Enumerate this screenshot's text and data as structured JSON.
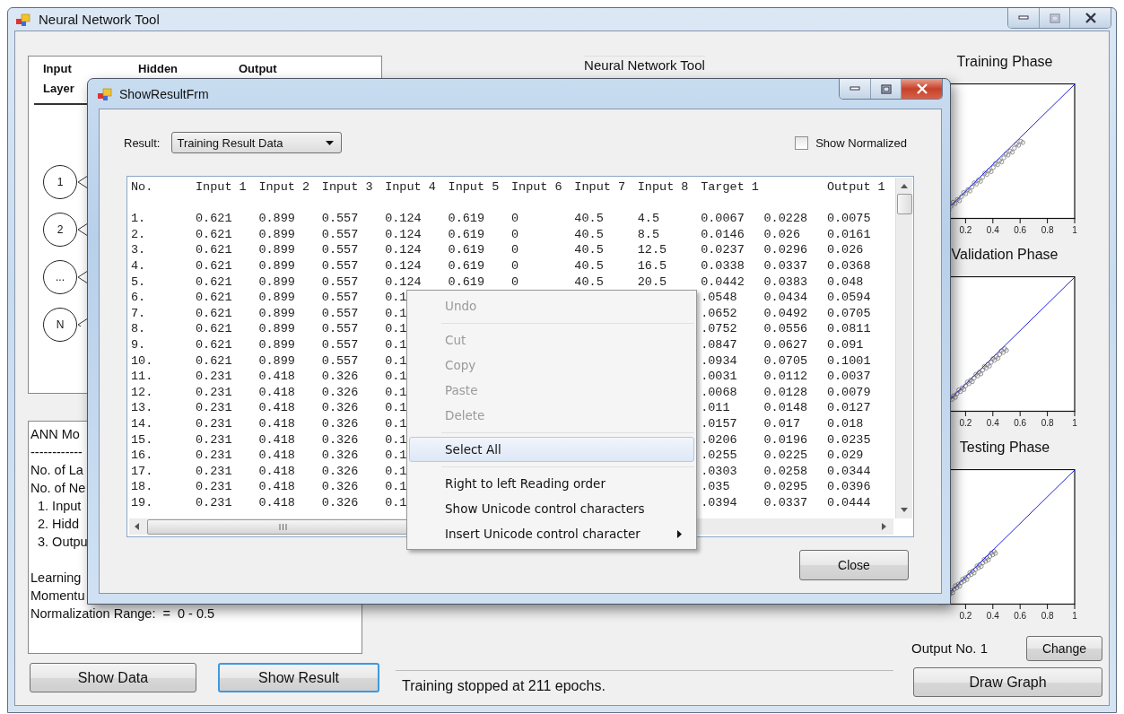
{
  "window": {
    "title": "Neural Network Tool"
  },
  "layer_tabs": [
    {
      "label": "Input Layer",
      "selected": true
    },
    {
      "label": "Hidden",
      "selected": false
    },
    {
      "label": "Output",
      "selected": false
    }
  ],
  "nodes": [
    "1",
    "2",
    "...",
    "N"
  ],
  "summary": {
    "header_lines": [
      "ANN Mo",
      "------------",
      "No. of La",
      "No. of Ne"
    ],
    "layer_lines": [
      "1. Input",
      "2. Hidd",
      "3. Outpu"
    ],
    "parameter_lines": [
      "Learning",
      "Momentu",
      "Normalization Range:  =  0 - 0.5"
    ]
  },
  "network_title": "Neural Network Tool",
  "actions": [
    {
      "label": "Show Data",
      "focused": false
    },
    {
      "label": "Show Result",
      "focused": true
    }
  ],
  "status": "Training stopped at 211 epochs.",
  "charts": [
    {
      "title": "Training Phase",
      "x_ticks": [
        "0.2",
        "0.4",
        "0.6",
        "0.8",
        "1"
      ]
    },
    {
      "title": "Validation Phase",
      "x_ticks": [
        "0.2",
        "0.4",
        "0.6",
        "0.8",
        "1"
      ]
    },
    {
      "title": "Testing Phase",
      "x_ticks": [
        "0.2",
        "0.4",
        "0.6",
        "0.8",
        "1"
      ]
    }
  ],
  "output_label": "Output No. 1",
  "change_button": "Change",
  "draw_graph_button": "Draw Graph",
  "dialog": {
    "title": "ShowResultFrm",
    "result_label": "Result:",
    "result_value": "Training Result Data",
    "show_normalized": {
      "label": "Show Normalized",
      "checked": false
    },
    "columns": [
      "No.",
      "Input 1",
      "Input 2",
      "Input 3",
      "Input 4",
      "Input 5",
      "Input 6",
      "Input 7",
      "Input 8",
      "Target 1",
      null,
      "Output 1"
    ],
    "rows": [
      [
        "1.",
        "0.621",
        "0.899",
        "0.557",
        "0.124",
        "0.619",
        "0",
        "40.5",
        "4.5",
        "0.0067",
        "0.0228",
        "0.0075"
      ],
      [
        "2.",
        "0.621",
        "0.899",
        "0.557",
        "0.124",
        "0.619",
        "0",
        "40.5",
        "8.5",
        "0.0146",
        "0.026",
        "0.0161"
      ],
      [
        "3.",
        "0.621",
        "0.899",
        "0.557",
        "0.124",
        "0.619",
        "0",
        "40.5",
        "12.5",
        "0.0237",
        "0.0296",
        "0.026"
      ],
      [
        "4.",
        "0.621",
        "0.899",
        "0.557",
        "0.124",
        "0.619",
        "0",
        "40.5",
        "16.5",
        "0.0338",
        "0.0337",
        "0.0368"
      ],
      [
        "5.",
        "0.621",
        "0.899",
        "0.557",
        "0.124",
        "0.619",
        "0",
        "40.5",
        "20.5",
        "0.0442",
        "0.0383",
        "0.048"
      ],
      [
        "6.",
        "0.621",
        "0.899",
        "0.557",
        "0.1",
        null,
        null,
        null,
        null,
        ".0548",
        "0.0434",
        "0.0594"
      ],
      [
        "7.",
        "0.621",
        "0.899",
        "0.557",
        "0.1",
        null,
        null,
        null,
        null,
        ".0652",
        "0.0492",
        "0.0705"
      ],
      [
        "8.",
        "0.621",
        "0.899",
        "0.557",
        "0.1",
        null,
        null,
        null,
        null,
        ".0752",
        "0.0556",
        "0.0811"
      ],
      [
        "9.",
        "0.621",
        "0.899",
        "0.557",
        "0.1",
        null,
        null,
        null,
        null,
        ".0847",
        "0.0627",
        "0.091"
      ],
      [
        "10.",
        "0.621",
        "0.899",
        "0.557",
        "0.1",
        null,
        null,
        null,
        null,
        ".0934",
        "0.0705",
        "0.1001"
      ],
      [
        "11.",
        "0.231",
        "0.418",
        "0.326",
        "0.1",
        null,
        null,
        null,
        null,
        ".0031",
        "0.0112",
        "0.0037"
      ],
      [
        "12.",
        "0.231",
        "0.418",
        "0.326",
        "0.1",
        null,
        null,
        null,
        null,
        ".0068",
        "0.0128",
        "0.0079"
      ],
      [
        "13.",
        "0.231",
        "0.418",
        "0.326",
        "0.1",
        null,
        null,
        null,
        null,
        ".011",
        "0.0148",
        "0.0127"
      ],
      [
        "14.",
        "0.231",
        "0.418",
        "0.326",
        "0.1",
        null,
        null,
        null,
        null,
        ".0157",
        "0.017",
        "0.018"
      ],
      [
        "15.",
        "0.231",
        "0.418",
        "0.326",
        "0.1",
        null,
        null,
        null,
        null,
        ".0206",
        "0.0196",
        "0.0235"
      ],
      [
        "16.",
        "0.231",
        "0.418",
        "0.326",
        "0.1",
        null,
        null,
        null,
        null,
        ".0255",
        "0.0225",
        "0.029"
      ],
      [
        "17.",
        "0.231",
        "0.418",
        "0.326",
        "0.1",
        null,
        null,
        null,
        null,
        ".0303",
        "0.0258",
        "0.0344"
      ],
      [
        "18.",
        "0.231",
        "0.418",
        "0.326",
        "0.1",
        null,
        null,
        null,
        null,
        ".035",
        "0.0295",
        "0.0396"
      ],
      [
        "19.",
        "0.231",
        "0.418",
        "0.326",
        "0.1",
        null,
        null,
        null,
        null,
        ".0394",
        "0.0337",
        "0.0444"
      ]
    ],
    "close_button": "Close"
  },
  "context_menu": [
    {
      "kind": "item",
      "label": "Undo",
      "disabled": true,
      "selected": false,
      "submenu": false
    },
    {
      "kind": "separator"
    },
    {
      "kind": "item",
      "label": "Cut",
      "disabled": true,
      "selected": false,
      "submenu": false
    },
    {
      "kind": "item",
      "label": "Copy",
      "disabled": true,
      "selected": false,
      "submenu": false
    },
    {
      "kind": "item",
      "label": "Paste",
      "disabled": true,
      "selected": false,
      "submenu": false
    },
    {
      "kind": "item",
      "label": "Delete",
      "disabled": true,
      "selected": false,
      "submenu": false
    },
    {
      "kind": "separator"
    },
    {
      "kind": "item",
      "label": "Select All",
      "disabled": false,
      "selected": true,
      "submenu": false
    },
    {
      "kind": "separator"
    },
    {
      "kind": "item",
      "label": "Right to left Reading order",
      "disabled": false,
      "selected": false,
      "submenu": false
    },
    {
      "kind": "item",
      "label": "Show Unicode control characters",
      "disabled": false,
      "selected": false,
      "submenu": false
    },
    {
      "kind": "item",
      "label": "Insert Unicode control character",
      "disabled": false,
      "selected": false,
      "submenu": true
    }
  ]
}
